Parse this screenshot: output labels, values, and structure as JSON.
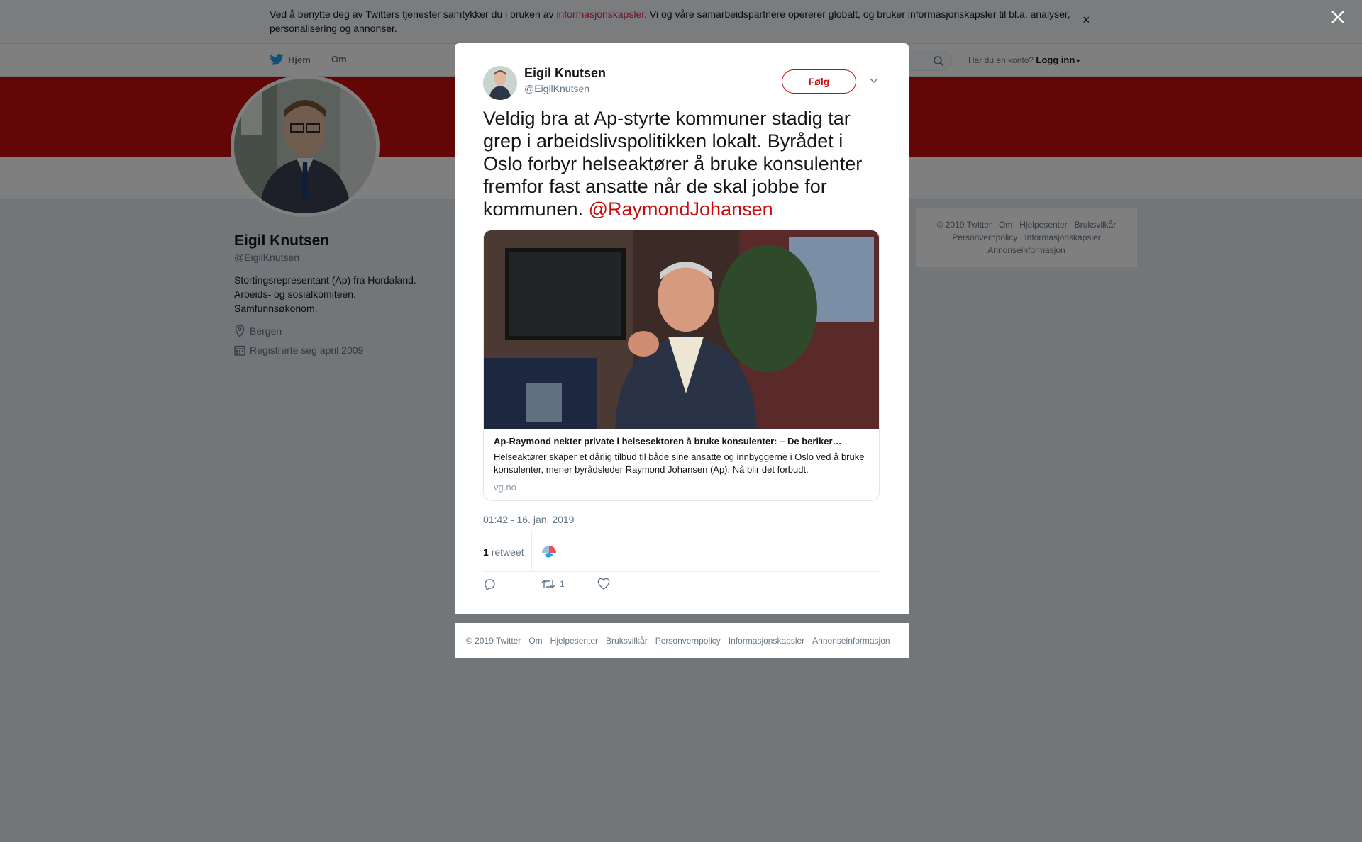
{
  "cookie": {
    "text_before": "Ved å benytte deg av Twitters tjenester samtykker du i bruken av ",
    "link": "informasjonskapsler",
    "text_after": ". Vi og våre samarbeidspartnere opererer globalt, og bruker informasjonskapsler til bl.a. analyser, personalisering og annonser.",
    "close": "×"
  },
  "nav": {
    "home": "Hjem",
    "about": "Om",
    "have_account": "Har du en konto?",
    "login": "Logg inn"
  },
  "profile": {
    "name": "Eigil Knutsen",
    "handle": "@EigilKnutsen",
    "bio": [
      "Stortingsrepresentant (Ap) fra Hordaland.",
      "Arbeids- og sosialkomiteen.",
      "Samfunnsøkonom."
    ],
    "location": "Bergen",
    "joined": "Registrerte seg april 2009"
  },
  "sidebar_footer": [
    "© 2019 Twitter",
    "Om",
    "Hjelpesenter",
    "Bruksvilkår",
    "Personvernpolicy",
    "Informasjonskapsler",
    "Annonseinformasjon"
  ],
  "tweet": {
    "author_name": "Eigil Knutsen",
    "author_handle": "@EigilKnutsen",
    "follow_label": "Følg",
    "text": "Veldig bra at Ap-styrte kommuner stadig tar grep i arbeidslivspolitikken lokalt. Byrådet i Oslo forbyr helseaktører å bruke konsulenter fremfor fast ansatte når de skal jobbe for kommunen. ",
    "mention": "@RaymondJohansen",
    "card": {
      "title": "Ap-Raymond nekter private i helsesektoren å bruke konsulenter: – De beriker…",
      "description": "Helseaktører skaper et dårlig tilbud til både sine ansatte og innbyggerne i Oslo ved å bruke konsulenter, mener byrådsleder Raymond Johansen (Ap). Nå blir det forbudt.",
      "domain": "vg.no"
    },
    "timestamp": "01:42 - 16. jan. 2019",
    "retweet_count": "1",
    "retweet_label": "retweet",
    "action_retweet_count": "1"
  },
  "modal_footer": [
    "© 2019 Twitter",
    "Om",
    "Hjelpesenter",
    "Bruksvilkår",
    "Personvernpolicy",
    "Informasjonskapsler",
    "Annonseinformasjon"
  ],
  "colors": {
    "brand": "#c70c0c",
    "link_red": "#e0245e",
    "text_secondary": "#657786"
  }
}
